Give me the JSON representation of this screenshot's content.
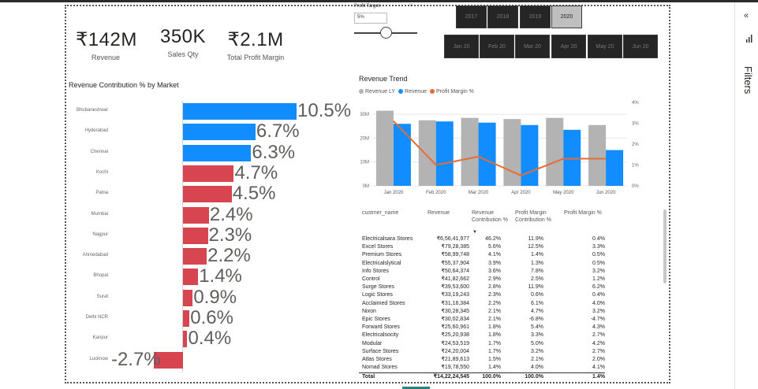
{
  "kpis": {
    "revenue": {
      "value": "₹142M",
      "label": "Revenue"
    },
    "sales_qty": {
      "value": "350K",
      "label": "Sales Qty"
    },
    "profit_margin": {
      "value": "₹2.1M",
      "label": "Total Profit Margin"
    }
  },
  "profit_target": {
    "title": "Profit Target",
    "value": "5%"
  },
  "years": [
    "2017",
    "2018",
    "2019",
    "2020"
  ],
  "selected_year": "2020",
  "months": [
    "Jan 20",
    "Feb 20",
    "Mar 20",
    "Apr 20",
    "May 20",
    "Jun 20"
  ],
  "revenue_contribution": {
    "title": "Revenue Contribution % by Market",
    "colors": {
      "positive_high": "#118dff",
      "positive_low": "#d64550",
      "negative": "#d64550"
    },
    "markets": [
      {
        "name": "Bhubaneshwar",
        "value": 10.5,
        "label": "10.5%"
      },
      {
        "name": "Hyderabad",
        "value": 6.7,
        "label": "6.7%"
      },
      {
        "name": "Chennai",
        "value": 6.3,
        "label": "6.3%"
      },
      {
        "name": "Kochi",
        "value": 4.7,
        "label": "4.7%"
      },
      {
        "name": "Patna",
        "value": 4.5,
        "label": "4.5%"
      },
      {
        "name": "Mumbai",
        "value": 2.4,
        "label": "2.4%"
      },
      {
        "name": "Nagpur",
        "value": 2.3,
        "label": "2.3%"
      },
      {
        "name": "Ahmedabad",
        "value": 2.2,
        "label": "2.2%"
      },
      {
        "name": "Bhopal",
        "value": 1.4,
        "label": "1.4%"
      },
      {
        "name": "Surat",
        "value": 0.9,
        "label": "0.9%"
      },
      {
        "name": "Delhi NCR",
        "value": 0.6,
        "label": "0.6%"
      },
      {
        "name": "Kanpur",
        "value": 0.4,
        "label": "0.4%"
      },
      {
        "name": "Lucknow",
        "value": -2.7,
        "label": "-2.7%"
      }
    ]
  },
  "chart_data": {
    "type": "bar",
    "title": "Revenue Trend",
    "categories": [
      "Jan 2020",
      "Feb 2020",
      "Mar 2020",
      "Apr 2020",
      "May 2020",
      "Jun 2020"
    ],
    "series": [
      {
        "name": "Revenue LY",
        "color": "#b3b3b3",
        "values": [
          31.5,
          27.5,
          28.5,
          28,
          28.5,
          25.5
        ]
      },
      {
        "name": "Revenue",
        "color": "#118dff",
        "values": [
          26,
          27,
          26.5,
          25.5,
          23.5,
          15
        ]
      },
      {
        "name": "Profit Margin %",
        "color": "#e66c37",
        "axis": "secondary",
        "values": [
          3.1,
          1.0,
          1.4,
          0.5,
          1.3,
          1.3
        ]
      }
    ],
    "y_ticks": [
      "0M",
      "10M",
      "20M",
      "30M"
    ],
    "y2_ticks": [
      "0%",
      "1%",
      "2%",
      "3%",
      "4%"
    ],
    "ylim": [
      0,
      35
    ],
    "y2lim": [
      0,
      4
    ]
  },
  "table": {
    "headers": [
      "custmer_name",
      "Revenue",
      "Revenue Contribution %",
      "Profit Margin Contribution %",
      "Profit Margin %"
    ],
    "rows": [
      [
        "Electricalsara Stores",
        "₹6,56,41,977",
        "46.2%",
        "11.9%",
        "0.4%"
      ],
      [
        "Excel Stores",
        "₹79,28,385",
        "5.6%",
        "12.5%",
        "3.3%"
      ],
      [
        "Premium Stores",
        "₹58,99,748",
        "4.1%",
        "1.4%",
        "0.5%"
      ],
      [
        "Electricalslytical",
        "₹55,37,904",
        "3.9%",
        "1.3%",
        "0.5%"
      ],
      [
        "Info Stores",
        "₹50,64,374",
        "3.6%",
        "7.8%",
        "3.2%"
      ],
      [
        "Control",
        "₹41,82,662",
        "2.9%",
        "2.5%",
        "1.2%"
      ],
      [
        "Surge Stores",
        "₹39,53,600",
        "2.8%",
        "11.9%",
        "6.2%"
      ],
      [
        "Logic Stores",
        "₹33,19,243",
        "2.3%",
        "0.6%",
        "0.4%"
      ],
      [
        "Acclaimed Stores",
        "₹31,16,384",
        "2.2%",
        "6.1%",
        "4.0%"
      ],
      [
        "Nixon",
        "₹30,28,345",
        "2.1%",
        "4.7%",
        "3.2%"
      ],
      [
        "Epic Stores",
        "₹30,02,834",
        "2.1%",
        "-6.8%",
        "-4.7%"
      ],
      [
        "Forward Stores",
        "₹25,60,961",
        "1.8%",
        "5.4%",
        "4.3%"
      ],
      [
        "Electricalsocity",
        "₹25,20,938",
        "1.8%",
        "3.3%",
        "2.7%"
      ],
      [
        "Modular",
        "₹24,53,519",
        "1.7%",
        "5.0%",
        "4.2%"
      ],
      [
        "Surface Stores",
        "₹24,20,004",
        "1.7%",
        "3.2%",
        "2.7%"
      ],
      [
        "Atlas Stores",
        "₹21,89,613",
        "1.5%",
        "2.1%",
        "2.0%"
      ],
      [
        "Nomad Stores",
        "₹19,78,550",
        "1.4%",
        "4.0%",
        "4.1%"
      ]
    ],
    "total": [
      "Total",
      "₹14,22,24,545",
      "100.0%",
      "100.0%",
      "1.4%"
    ]
  },
  "filters_pane": {
    "label": "Filters",
    "collapse_icon": "chevrons-left-icon",
    "icon": "bar-chart-icon"
  }
}
